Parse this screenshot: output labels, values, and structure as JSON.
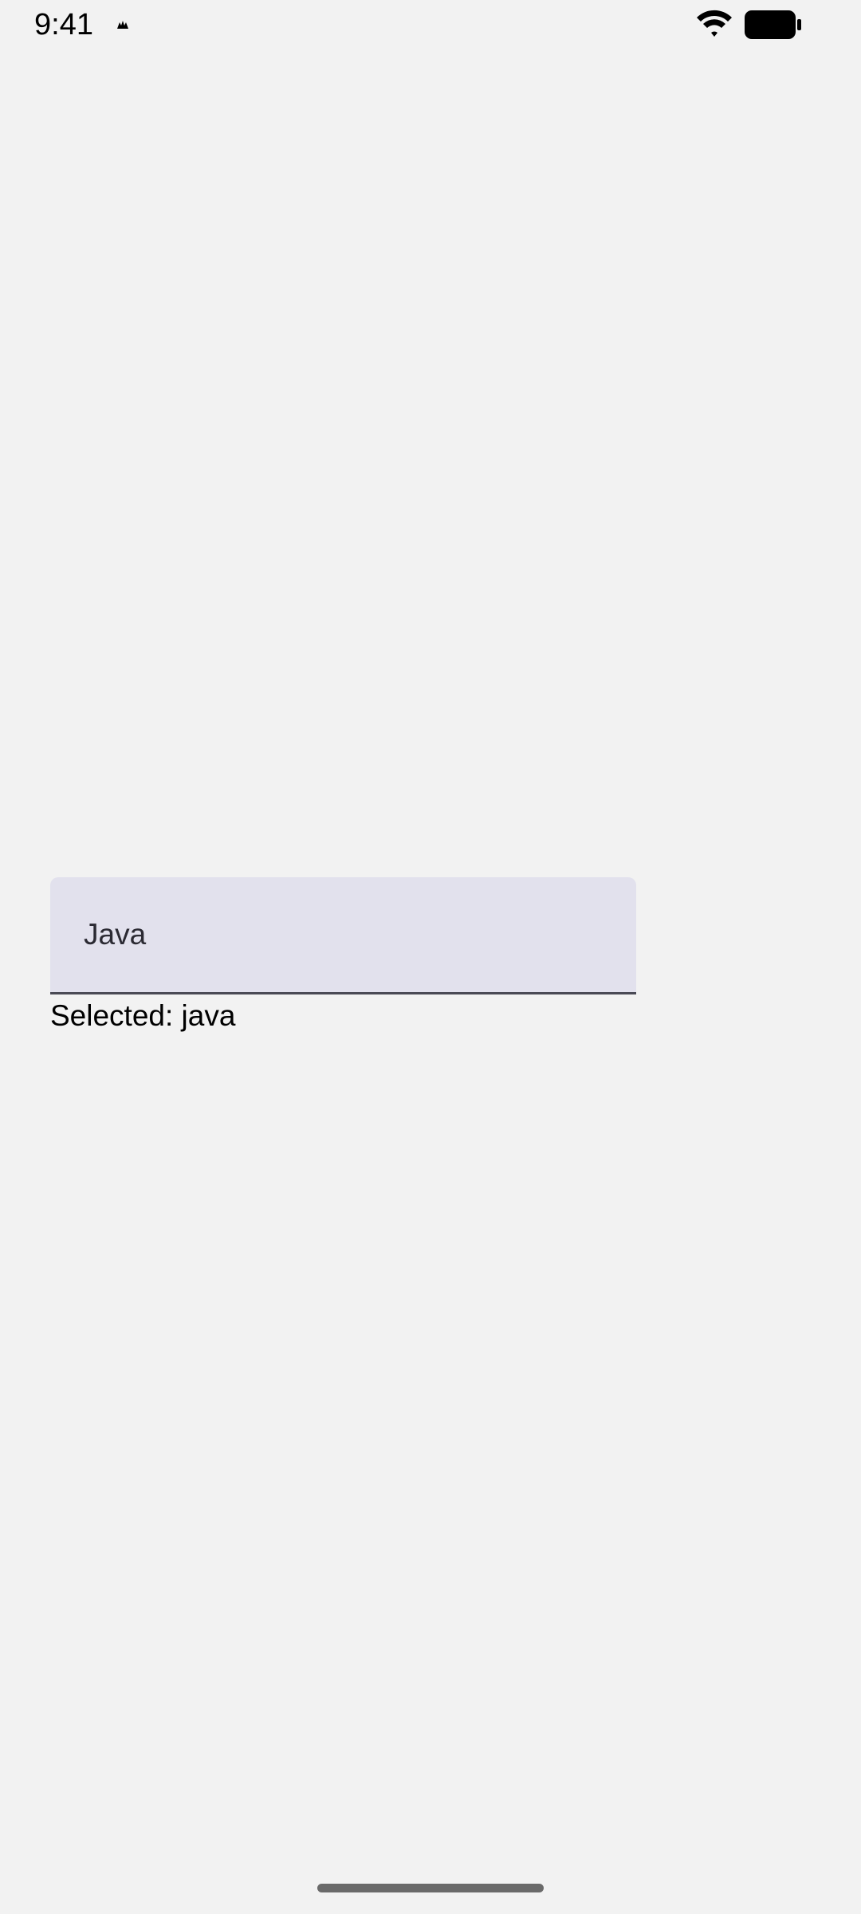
{
  "status_bar": {
    "time": "9:41",
    "notification_icon": "android-notification-icon",
    "wifi_icon": "wifi-icon",
    "battery_icon": "battery-icon"
  },
  "dropdown": {
    "value": "Java",
    "background": "#e2e1ed",
    "indicator_color": "#4a4a55"
  },
  "selection": {
    "text": "Selected: java"
  }
}
